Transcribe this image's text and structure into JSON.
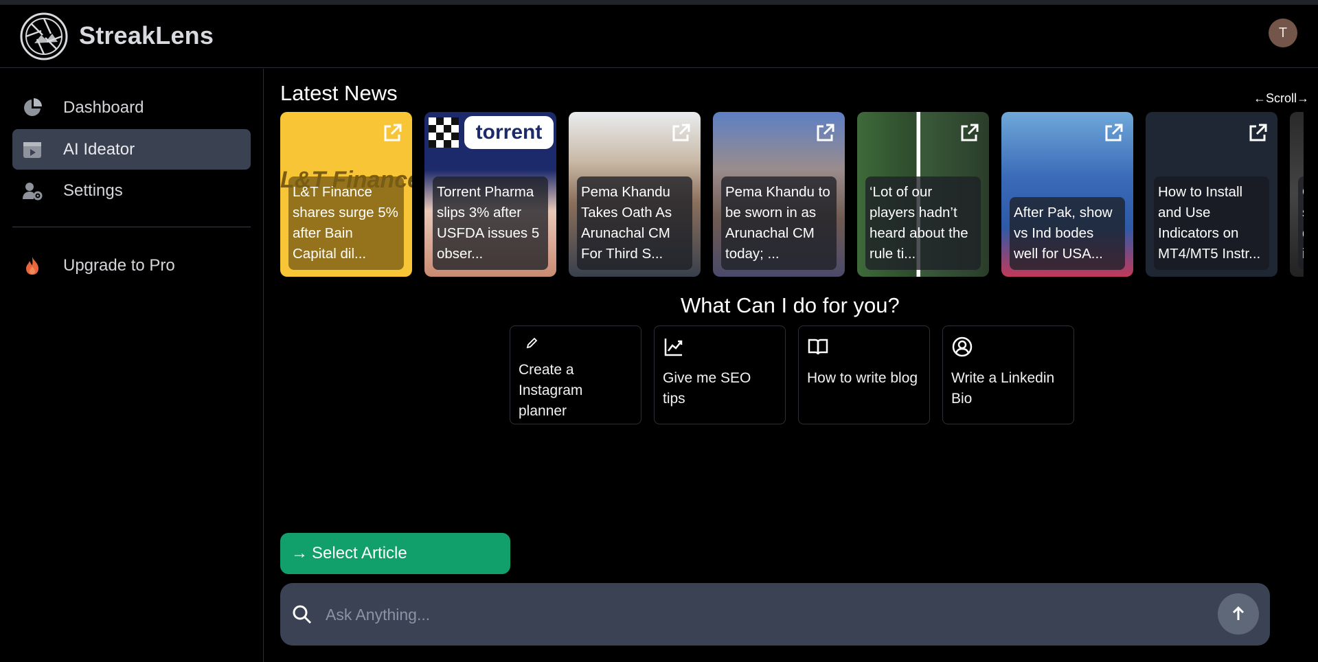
{
  "app": {
    "brand": "StreakLens",
    "avatar_letter": "T"
  },
  "sidebar": {
    "items": [
      {
        "label": "Dashboard",
        "icon": "pie-chart-icon",
        "active": false
      },
      {
        "label": "AI Ideator",
        "icon": "video-clip-icon",
        "active": true
      },
      {
        "label": "Settings",
        "icon": "user-gear-icon",
        "active": false
      }
    ],
    "upgrade": {
      "label": "Upgrade to Pro",
      "icon": "flame-icon"
    }
  },
  "news": {
    "title": "Latest News",
    "scroll_hint": "←Scroll→",
    "cards": [
      {
        "caption": "L&T Finance shares surge 5% after Bain Capital dil...",
        "image_text": "L&T Finance"
      },
      {
        "caption": "Torrent Pharma slips 3% after USFDA issues 5 obser...",
        "image_text": "torrent"
      },
      {
        "caption": "Pema Khandu Takes Oath As Arunachal CM For Third S..."
      },
      {
        "caption": "Pema Khandu to be sworn in as Arunachal CM today; ..."
      },
      {
        "caption": "‘Lot of our players hadn’t heard about the rule ti..."
      },
      {
        "caption": "After Pak, show vs Ind bodes well for USA..."
      },
      {
        "caption": "How to Install and Use Indicators on MT4/MT5 Instr..."
      },
      {
        "caption": "O... sa... d... in..."
      }
    ]
  },
  "help": {
    "title": "What Can I do for you?",
    "suggestions": [
      {
        "label": "Create a Instagram planner",
        "icon": "pencil-icon"
      },
      {
        "label": "Give me SEO tips",
        "icon": "trend-chart-icon"
      },
      {
        "label": "How to write blog",
        "icon": "open-book-icon"
      },
      {
        "label": "Write a Linkedin Bio",
        "icon": "user-circle-icon"
      }
    ]
  },
  "composer": {
    "select_article_label": "Select Article",
    "placeholder": "Ask Anything..."
  },
  "colors": {
    "accent_green": "#11a06b",
    "active_nav": "#3a4150",
    "input_bg": "#3a4254"
  }
}
